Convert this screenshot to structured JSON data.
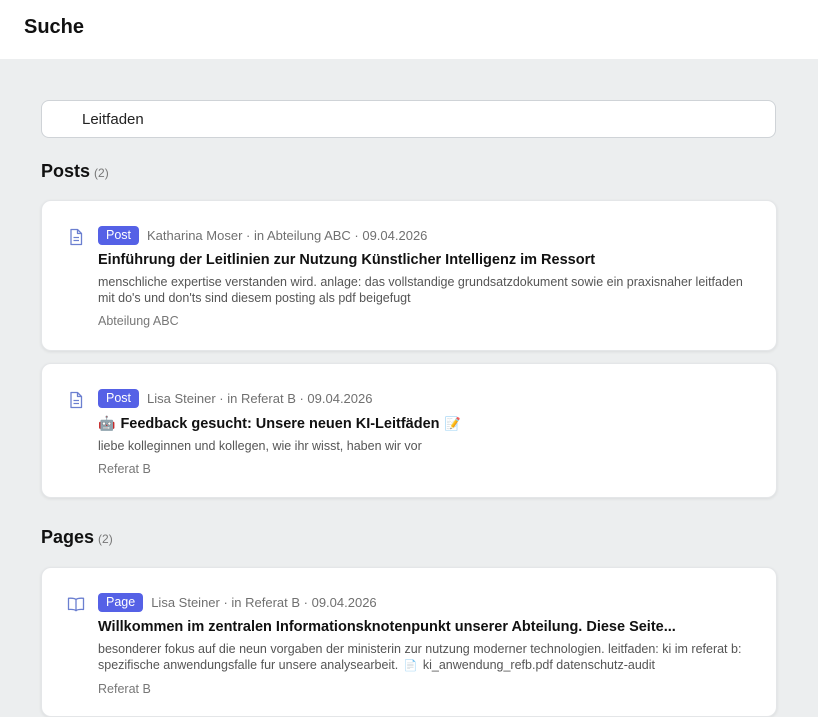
{
  "header": {
    "title": "Suche"
  },
  "search": {
    "value": "Leitfaden"
  },
  "sections": {
    "posts": {
      "title": "Posts",
      "count": "(2)"
    },
    "pages": {
      "title": "Pages",
      "count": "(2)"
    }
  },
  "posts": [
    {
      "badge": "Post",
      "meta": "Katharina Moser · in Abteilung ABC · 09.04.2026",
      "title": "Einführung der Leitlinien zur Nutzung Künstlicher Intelligenz im Ressort",
      "excerpt": "menschliche expertise verstanden wird. anlage: das vollstandige grundsatzdokument sowie ein praxisnaher leitfaden mit do's und don'ts sind diesem posting als pdf beigefugt",
      "location": "Abteilung ABC",
      "icon": "document-icon"
    },
    {
      "badge": "Post",
      "meta": "Lisa Steiner · in Referat B · 09.04.2026",
      "title_emoji": "🤖",
      "title": "Feedback gesucht: Unsere neuen KI-Leitfäden",
      "title_emoji_after": "📝",
      "excerpt": "liebe kolleginnen und kollegen, wie ihr wisst, haben wir vor",
      "location": "Referat B",
      "icon": "document-icon"
    }
  ],
  "pages": [
    {
      "badge": "Page",
      "meta": "Lisa Steiner · in Referat B · 09.04.2026",
      "title": "Willkommen im zentralen Informationsknotenpunkt unserer Abteilung. Diese Seite...",
      "excerpt_part1": "besonderer fokus auf die neun vorgaben der ministerin zur nutzung moderner technologien. leitfaden: ki im referat b: spezifische anwendungsfalle fur unsere analysearbeit.",
      "excerpt_file_glyph": "📄",
      "excerpt_part2": "ki_anwendung_refb.pdf datenschutz-audit",
      "location": "Referat B",
      "icon": "book-icon"
    }
  ],
  "colors": {
    "badge": "#5561e6",
    "background": "#eceeef",
    "icon": "#6b7fd0"
  }
}
